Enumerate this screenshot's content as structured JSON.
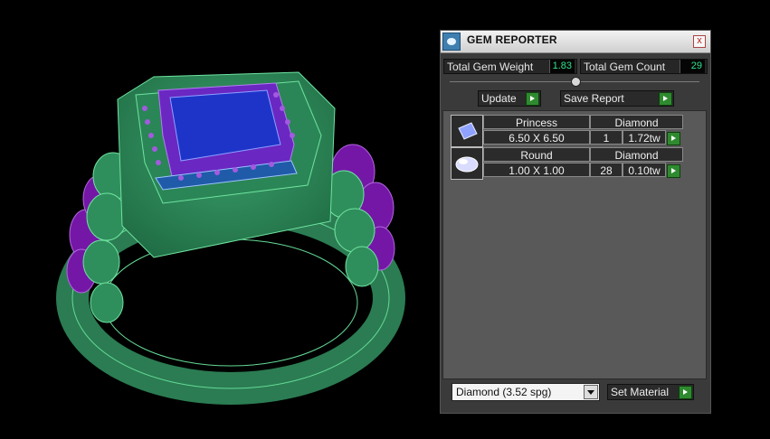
{
  "panel": {
    "title": "GEM REPORTER",
    "close_label": "x",
    "total_gem_weight_label": "Total Gem Weight",
    "total_gem_weight": "1.83",
    "total_gem_count_label": "Total Gem Count",
    "total_gem_count": "29",
    "update_label": "Update",
    "save_report_label": "Save Report"
  },
  "gems": [
    {
      "shape": "Princess",
      "material": "Diamond",
      "size": "6.50 X 6.50",
      "count": "1",
      "weight": "1.72tw"
    },
    {
      "shape": "Round",
      "material": "Diamond",
      "size": "1.00 X 1.00",
      "count": "28",
      "weight": "0.10tw"
    }
  ],
  "material_select": {
    "value": "Diamond     (3.52 spg)"
  },
  "set_material_label": "Set Material",
  "colors": {
    "metal": "#2e8a5c",
    "wire_green": "#5bd68f",
    "purple": "#7a1fa8",
    "stone_blue": "#1f33c8"
  }
}
